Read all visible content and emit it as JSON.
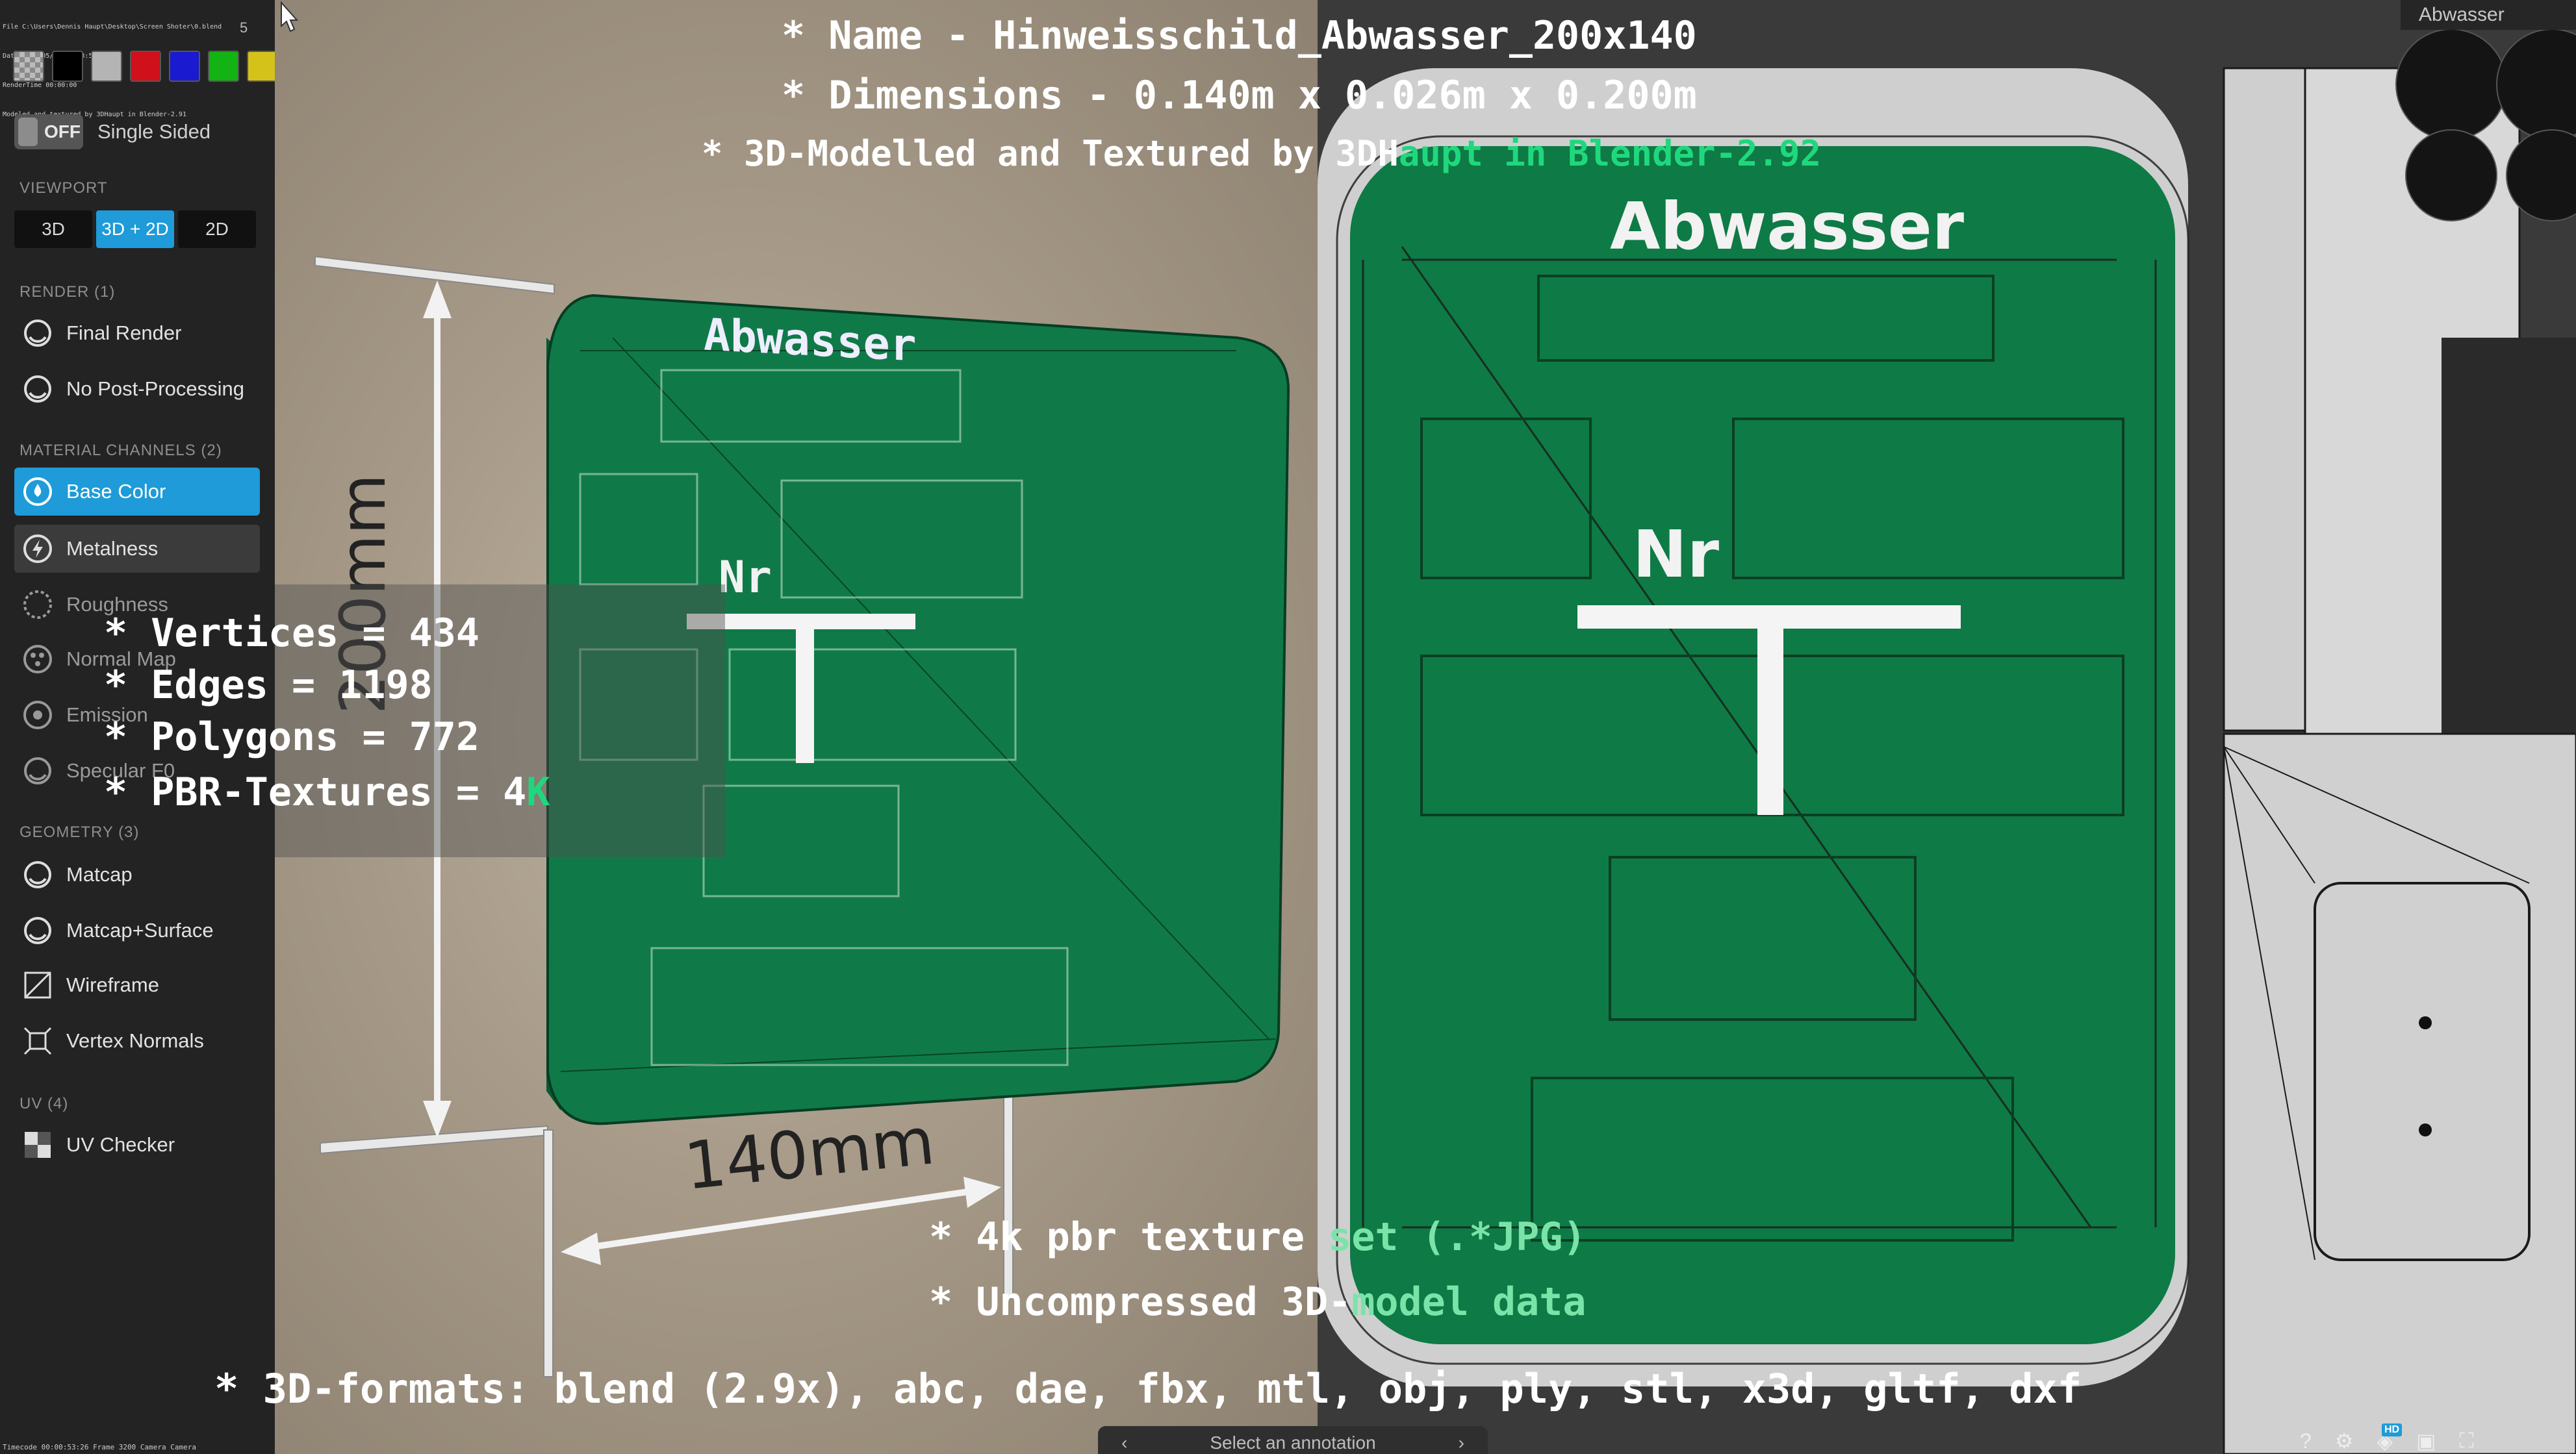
{
  "sidebar": {
    "file_info": [
      "File C:\\Users\\Dennis Haupt\\Desktop\\Screen Shoter\\0.blend",
      "Date 2021/05/01 15:33:53",
      "RenderTime 00:00:00",
      "Modeled and textured by 3DHaupt in Blender-2.91"
    ],
    "top_number": "5",
    "swatch_colors": [
      "checker",
      "#000000",
      "#b4b4b4",
      "#d0101a",
      "#1a1ad0",
      "#13b313",
      "#d4c21a"
    ],
    "single_sided": {
      "state": "OFF",
      "label": "Single Sided"
    },
    "viewport": {
      "title": "VIEWPORT",
      "buttons": [
        "3D",
        "3D + 2D",
        "2D"
      ],
      "active": "3D + 2D"
    },
    "render": {
      "title": "RENDER (1)",
      "items": [
        {
          "label": "Final Render",
          "icon": "sphere-icon"
        },
        {
          "label": "No Post-Processing",
          "icon": "sphere-icon"
        }
      ]
    },
    "material": {
      "title": "MATERIAL CHANNELS (2)",
      "items": [
        {
          "label": "Base Color",
          "icon": "droplet-icon",
          "state": "active"
        },
        {
          "label": "Metalness",
          "icon": "lightning-icon",
          "state": "selected"
        },
        {
          "label": "Roughness",
          "icon": "roughness-icon"
        },
        {
          "label": "Normal Map",
          "icon": "normal-map-icon"
        },
        {
          "label": "Emission",
          "icon": "sun-icon"
        },
        {
          "label": "Specular F0",
          "icon": "sphere-icon"
        }
      ]
    },
    "geometry": {
      "title": "GEOMETRY (3)",
      "items": [
        {
          "label": "Matcap",
          "icon": "sphere-icon"
        },
        {
          "label": "Matcap+Surface",
          "icon": "sphere-icon"
        },
        {
          "label": "Wireframe",
          "icon": "wireframe-icon"
        },
        {
          "label": "Vertex Normals",
          "icon": "vertex-normals-icon"
        }
      ]
    },
    "uv": {
      "title": "UV (4)",
      "items": [
        {
          "label": "UV Checker",
          "icon": "checker-icon"
        }
      ]
    }
  },
  "overlay": {
    "name_line": "* Name - Hinweisschild_Abwasser_200x140",
    "dimensions_line": "* Dimensions -  0.140m x 0.026m x 0.200m",
    "credit_prefix": "* 3D-Modelled and Textured by 3DH",
    "credit_suffix": "aupt in Blender-2.92",
    "vertices": "* Vertices = 434",
    "edges": "* Edges = 1198",
    "polygons": "* Polygons = 772",
    "pbr_prefix": "* PBR-Textures = 4",
    "pbr_suffix": "K",
    "texture_prefix": "* 4k pbr texture ",
    "texture_suffix": "set (.*JPG)",
    "uncompressed_prefix": "* Uncompressed 3D-",
    "uncompressed_suffix": "model data",
    "formats": "* 3D-formats: blend (2.9x), abc, dae, fbx, mtl, obj, ply, stl, x3d, gltf, dxf"
  },
  "model": {
    "sign_title": "Abwasser",
    "sign_nr": "Nr",
    "height_label": "200mm",
    "width_label": "140mm",
    "sign_color": "#0f7a48"
  },
  "uv_panel": {
    "label": "Abwasser",
    "sign_title": "Abwasser",
    "sign_nr": "Nr",
    "sign_color": "#0e7a45"
  },
  "bottom": {
    "annotation_placeholder": "Select an annotation",
    "prev": "‹",
    "next": "›",
    "timecode": "Timecode 00:00:53:26    Frame 3200    Camera Camera",
    "hd": "HD"
  }
}
